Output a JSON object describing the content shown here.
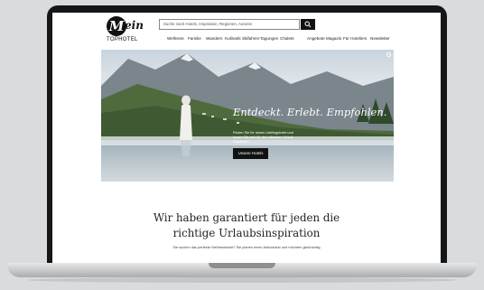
{
  "header": {
    "logo_mark": "M",
    "logo_script": "ein",
    "logo_sub": "TOPHOTEL",
    "search_placeholder": "Suche nach Hotels, Inspiration, Regionen, Autoren",
    "nav_left": [
      "Wellness",
      "Familie",
      "Wandern",
      "Kulinarik",
      "Skifahren",
      "Tagungen",
      "Chalets"
    ],
    "nav_right": [
      "Angebote",
      "Magazin",
      "Für Hoteliers",
      "Newsletter"
    ]
  },
  "hero": {
    "title": "Entdeckt. Erlebt. Empfohlen.",
    "subtitle": "Finden Sie Ihr neues Lieblingshotel und lassen Sie sich für den nächsten Urlaub inspirieren.",
    "button": "Unsere Hotels"
  },
  "content": {
    "headline_line1": "Wir haben garantiert für jeden die",
    "headline_line2": "richtige Urlaubsinspiration",
    "subline": "Sie suchen das perfekte Wellnesshotel? Sie planen einen Aktivurlaub und möchten gleichzeitig"
  }
}
